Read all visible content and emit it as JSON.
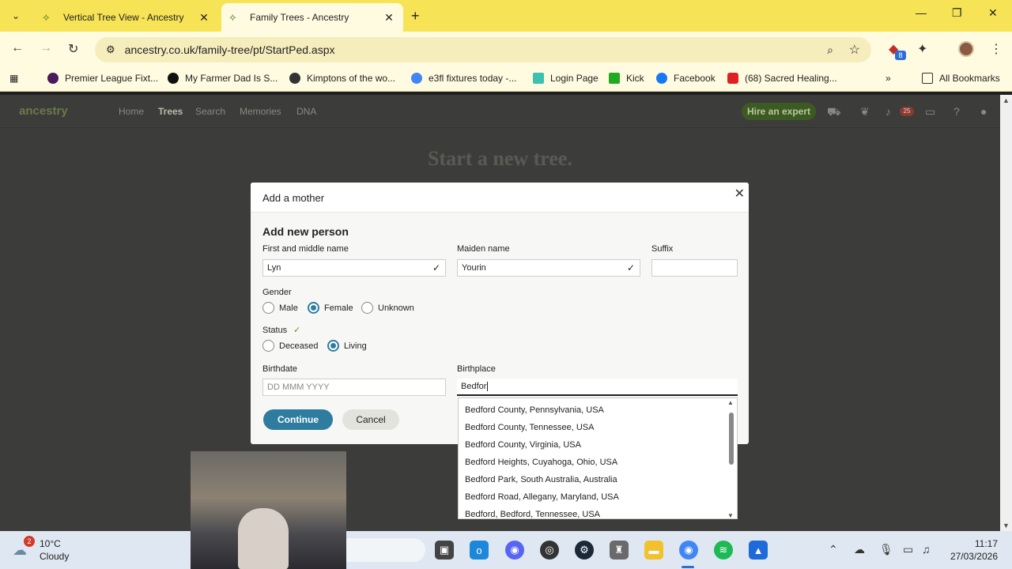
{
  "browser": {
    "tabs": [
      {
        "title": "Vertical Tree View - Ancestry",
        "active": false
      },
      {
        "title": "Family Trees - Ancestry",
        "active": true
      }
    ],
    "url": "ancestry.co.uk/family-tree/pt/StartPed.aspx",
    "extension_badge": "8",
    "bookmarks": [
      {
        "label": "Premier League Fixt...",
        "icon": "premier-league-icon"
      },
      {
        "label": "My Farmer Dad Is S...",
        "icon": "tiktok-icon"
      },
      {
        "label": "Kimptons of the wo...",
        "icon": "globe-icon"
      },
      {
        "label": "e3fl fixtures today -...",
        "icon": "google-icon"
      },
      {
        "label": "Login Page",
        "icon": "login-icon"
      },
      {
        "label": "Kick",
        "icon": "kick-icon"
      },
      {
        "label": "Facebook",
        "icon": "facebook-icon"
      },
      {
        "label": "(68) Sacred Healing...",
        "icon": "youtube-icon"
      }
    ],
    "all_bookmarks": "All Bookmarks"
  },
  "ancestry": {
    "logo": "ancestry",
    "nav": [
      "Home",
      "Trees",
      "Search",
      "Memories",
      "DNA"
    ],
    "active_nav": "Trees",
    "hire_button": "Hire an expert",
    "notification_count": "25",
    "page_title": "Start a new tree."
  },
  "modal": {
    "title": "Add a mother",
    "section": "Add new person",
    "first_name_label": "First and middle name",
    "first_name_value": "Lyn",
    "maiden_label": "Maiden name",
    "maiden_value": "Yourin",
    "suffix_label": "Suffix",
    "suffix_value": "",
    "gender_label": "Gender",
    "gender_options": [
      "Male",
      "Female",
      "Unknown"
    ],
    "gender_selected": "Female",
    "status_label": "Status",
    "status_options": [
      "Deceased",
      "Living"
    ],
    "status_selected": "Living",
    "birthdate_label": "Birthdate",
    "birthdate_placeholder": "DD MMM YYYY",
    "birthplace_label": "Birthplace",
    "birthplace_value": "Bedfor",
    "continue": "Continue",
    "cancel": "Cancel",
    "suggestions": [
      "Bedford County, Pennsylvania, USA",
      "Bedford County, Tennessee, USA",
      "Bedford County, Virginia, USA",
      "Bedford Heights, Cuyahoga, Ohio, USA",
      "Bedford Park, South Australia, Australia",
      "Bedford Road, Allegany, Maryland, USA",
      "Bedford, Bedford, Tennessee, USA"
    ]
  },
  "taskbar": {
    "weather_badge": "2",
    "temperature": "10°C",
    "condition": "Cloudy",
    "time": "11:17",
    "date": "27/03/2026"
  },
  "colors": {
    "tabstrip": "#f6e356",
    "accent": "#2e7da0",
    "hire": "#3d5a22"
  }
}
